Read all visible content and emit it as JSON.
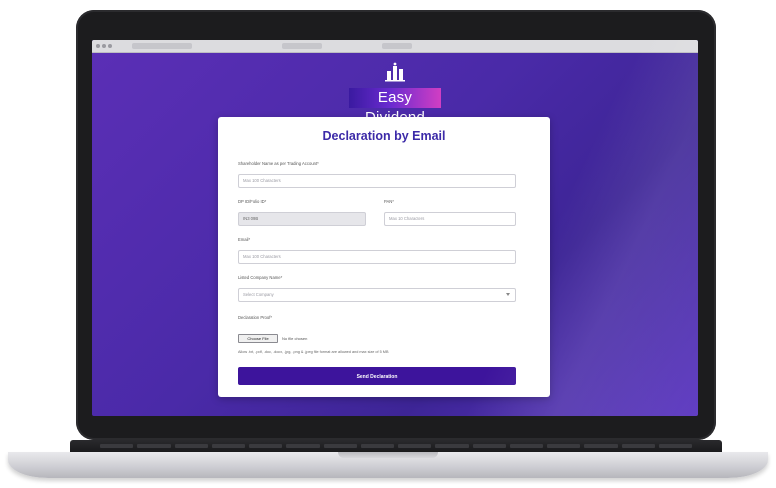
{
  "brand": {
    "name": "Easy Dividend",
    "icon": "city-skyline-icon"
  },
  "form": {
    "title": "Declaration by Email",
    "fields": {
      "shareholder_name": {
        "label": "Shareholder Name as per Trading Account*",
        "placeholder": "Max 100 Characters"
      },
      "dp_folio": {
        "label": "DP ID/Folio ID*",
        "value": "IN3 09B"
      },
      "pan": {
        "label": "PAN*",
        "placeholder": "Max 10 Characters"
      },
      "email": {
        "label": "Email*",
        "placeholder": "Max 100 Characters"
      },
      "company": {
        "label": "Listed Company Name*",
        "selected": "Select Company"
      },
      "declaration_proof": {
        "label": "Declaration Proof*",
        "button": "Choose File",
        "status": "No file chosen",
        "hint": "Allow .txt, .pdf, .doc, .docx, .jpg, .png & .jpeg file format are allowed and max size of 5 MB"
      }
    },
    "submit_label": "Send Declaration"
  },
  "colors": {
    "background_purple": "#4a2aa8",
    "accent": "#3d149c",
    "title": "#3c2aa8"
  }
}
